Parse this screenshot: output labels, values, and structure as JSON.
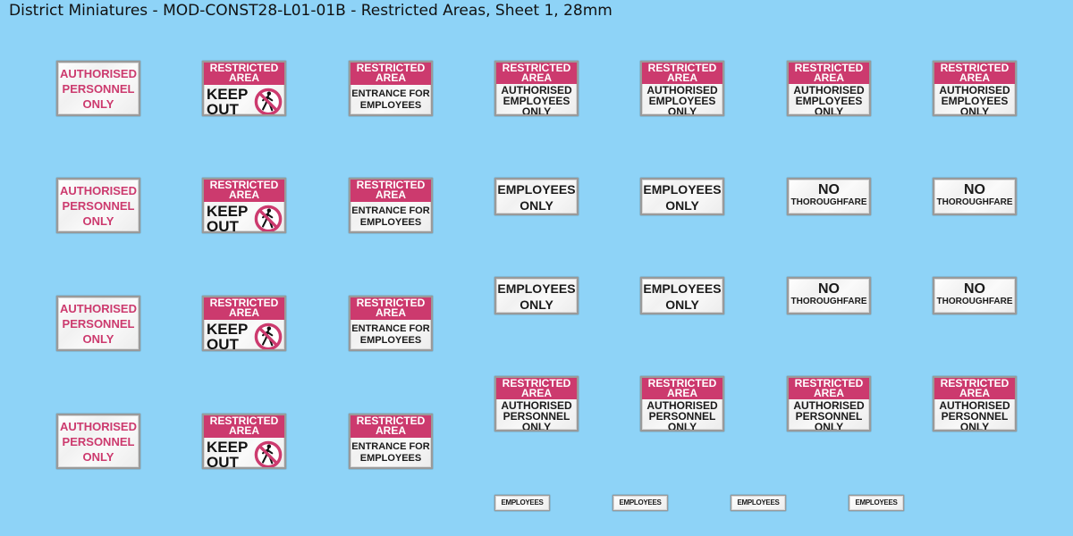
{
  "title": "District Miniatures - MOD-CONST28-L01-01B - Restricted Areas, Sheet 1, 28mm",
  "colors": {
    "background": "#8ed3f7",
    "accent": "#cc3a6e"
  },
  "labels": {
    "restricted": "RESTRICTED",
    "area": "AREA",
    "authorised": "AUTHORISED",
    "personnel": "PERSONNEL",
    "only": "ONLY",
    "keep": "KEEP",
    "out": "OUT",
    "entrance_for": "ENTRANCE FOR",
    "employees": "EMPLOYEES",
    "no": "NO",
    "thoroughfare": "THOROUGHFARE",
    "employees_only": "EMPLOYEES ONLY"
  },
  "icons": {
    "no_pedestrian": "no-pedestrian-icon"
  }
}
